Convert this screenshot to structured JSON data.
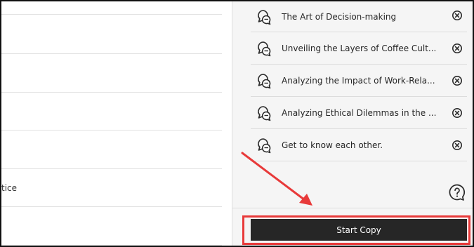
{
  "left_list": {
    "rows": [
      {
        "text": ""
      },
      {
        "text": ""
      },
      {
        "text": ""
      },
      {
        "text": ""
      },
      {
        "text": "tice"
      },
      {
        "text": ""
      }
    ]
  },
  "selected_courses": {
    "items": [
      {
        "title": "The Art of Decision-making"
      },
      {
        "title": "Unveiling the Layers of Coffee Cult..."
      },
      {
        "title": "Analyzing the Impact of Work-Rela..."
      },
      {
        "title": "Analyzing Ethical Dilemmas in the ..."
      },
      {
        "title": "Get to know each other."
      }
    ],
    "item_icon": "discussion-bubbles-icon",
    "remove_icon": "remove-circle-x-icon"
  },
  "help": {
    "icon": "help-question-icon"
  },
  "footer": {
    "start_copy_label": "Start Copy"
  },
  "annotation": {
    "color": "#e83a3a"
  }
}
